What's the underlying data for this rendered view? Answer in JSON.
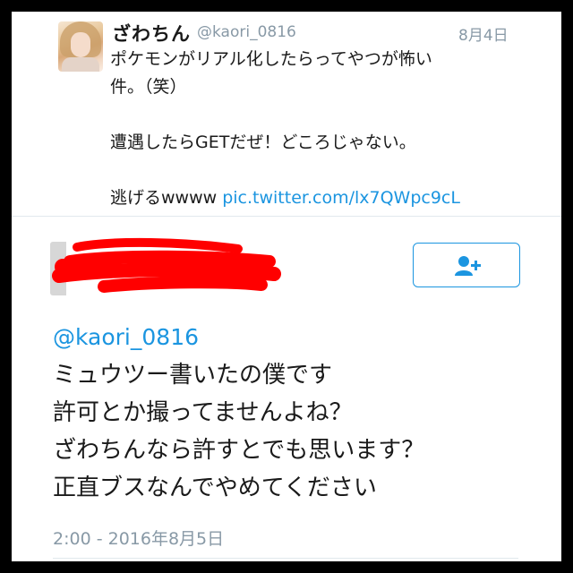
{
  "tweet1": {
    "display_name": "ざわちん",
    "handle": "@kaori_0816",
    "date": "8月4日",
    "lines": [
      "ポケモンがリアル化したらってやつが怖い",
      "件。（笑）",
      "",
      "遭遇したらGETだぜ！どころじゃない。",
      ""
    ],
    "last_line_text": "逃げるwwww ",
    "link": "pic.twitter.com/lx7QWpc9cL"
  },
  "tweet2": {
    "follow_icon": "add-user-icon",
    "mention": "@kaori_0816",
    "lines": [
      "ミュウツー書いたの僕です",
      "許可とか撮ってませんよね？",
      "ざわちんなら許すとでも思います？",
      "正直ブスなんでやめてください"
    ],
    "timestamp": "2:00 - 2016年8月5日"
  },
  "colors": {
    "link": "#1b95e0",
    "muted": "#8899a6",
    "redaction": "#ff0000",
    "frame": "#000000"
  }
}
